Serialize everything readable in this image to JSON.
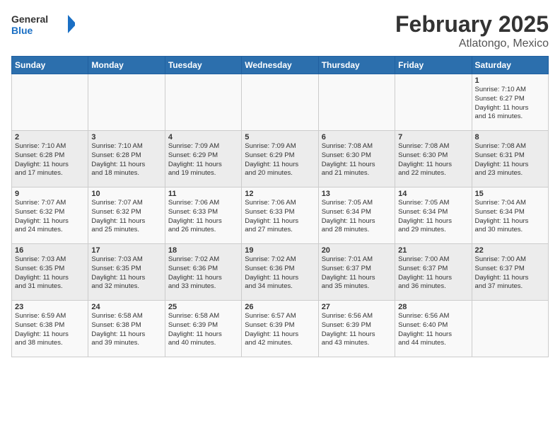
{
  "header": {
    "logo_general": "General",
    "logo_blue": "Blue",
    "month_title": "February 2025",
    "location": "Atlatongo, Mexico"
  },
  "weekdays": [
    "Sunday",
    "Monday",
    "Tuesday",
    "Wednesday",
    "Thursday",
    "Friday",
    "Saturday"
  ],
  "weeks": [
    [
      {
        "day": "",
        "info": ""
      },
      {
        "day": "",
        "info": ""
      },
      {
        "day": "",
        "info": ""
      },
      {
        "day": "",
        "info": ""
      },
      {
        "day": "",
        "info": ""
      },
      {
        "day": "",
        "info": ""
      },
      {
        "day": "1",
        "info": "Sunrise: 7:10 AM\nSunset: 6:27 PM\nDaylight: 11 hours\nand 16 minutes."
      }
    ],
    [
      {
        "day": "2",
        "info": "Sunrise: 7:10 AM\nSunset: 6:28 PM\nDaylight: 11 hours\nand 17 minutes."
      },
      {
        "day": "3",
        "info": "Sunrise: 7:10 AM\nSunset: 6:28 PM\nDaylight: 11 hours\nand 18 minutes."
      },
      {
        "day": "4",
        "info": "Sunrise: 7:09 AM\nSunset: 6:29 PM\nDaylight: 11 hours\nand 19 minutes."
      },
      {
        "day": "5",
        "info": "Sunrise: 7:09 AM\nSunset: 6:29 PM\nDaylight: 11 hours\nand 20 minutes."
      },
      {
        "day": "6",
        "info": "Sunrise: 7:08 AM\nSunset: 6:30 PM\nDaylight: 11 hours\nand 21 minutes."
      },
      {
        "day": "7",
        "info": "Sunrise: 7:08 AM\nSunset: 6:30 PM\nDaylight: 11 hours\nand 22 minutes."
      },
      {
        "day": "8",
        "info": "Sunrise: 7:08 AM\nSunset: 6:31 PM\nDaylight: 11 hours\nand 23 minutes."
      }
    ],
    [
      {
        "day": "9",
        "info": "Sunrise: 7:07 AM\nSunset: 6:32 PM\nDaylight: 11 hours\nand 24 minutes."
      },
      {
        "day": "10",
        "info": "Sunrise: 7:07 AM\nSunset: 6:32 PM\nDaylight: 11 hours\nand 25 minutes."
      },
      {
        "day": "11",
        "info": "Sunrise: 7:06 AM\nSunset: 6:33 PM\nDaylight: 11 hours\nand 26 minutes."
      },
      {
        "day": "12",
        "info": "Sunrise: 7:06 AM\nSunset: 6:33 PM\nDaylight: 11 hours\nand 27 minutes."
      },
      {
        "day": "13",
        "info": "Sunrise: 7:05 AM\nSunset: 6:34 PM\nDaylight: 11 hours\nand 28 minutes."
      },
      {
        "day": "14",
        "info": "Sunrise: 7:05 AM\nSunset: 6:34 PM\nDaylight: 11 hours\nand 29 minutes."
      },
      {
        "day": "15",
        "info": "Sunrise: 7:04 AM\nSunset: 6:34 PM\nDaylight: 11 hours\nand 30 minutes."
      }
    ],
    [
      {
        "day": "16",
        "info": "Sunrise: 7:03 AM\nSunset: 6:35 PM\nDaylight: 11 hours\nand 31 minutes."
      },
      {
        "day": "17",
        "info": "Sunrise: 7:03 AM\nSunset: 6:35 PM\nDaylight: 11 hours\nand 32 minutes."
      },
      {
        "day": "18",
        "info": "Sunrise: 7:02 AM\nSunset: 6:36 PM\nDaylight: 11 hours\nand 33 minutes."
      },
      {
        "day": "19",
        "info": "Sunrise: 7:02 AM\nSunset: 6:36 PM\nDaylight: 11 hours\nand 34 minutes."
      },
      {
        "day": "20",
        "info": "Sunrise: 7:01 AM\nSunset: 6:37 PM\nDaylight: 11 hours\nand 35 minutes."
      },
      {
        "day": "21",
        "info": "Sunrise: 7:00 AM\nSunset: 6:37 PM\nDaylight: 11 hours\nand 36 minutes."
      },
      {
        "day": "22",
        "info": "Sunrise: 7:00 AM\nSunset: 6:37 PM\nDaylight: 11 hours\nand 37 minutes."
      }
    ],
    [
      {
        "day": "23",
        "info": "Sunrise: 6:59 AM\nSunset: 6:38 PM\nDaylight: 11 hours\nand 38 minutes."
      },
      {
        "day": "24",
        "info": "Sunrise: 6:58 AM\nSunset: 6:38 PM\nDaylight: 11 hours\nand 39 minutes."
      },
      {
        "day": "25",
        "info": "Sunrise: 6:58 AM\nSunset: 6:39 PM\nDaylight: 11 hours\nand 40 minutes."
      },
      {
        "day": "26",
        "info": "Sunrise: 6:57 AM\nSunset: 6:39 PM\nDaylight: 11 hours\nand 42 minutes."
      },
      {
        "day": "27",
        "info": "Sunrise: 6:56 AM\nSunset: 6:39 PM\nDaylight: 11 hours\nand 43 minutes."
      },
      {
        "day": "28",
        "info": "Sunrise: 6:56 AM\nSunset: 6:40 PM\nDaylight: 11 hours\nand 44 minutes."
      },
      {
        "day": "",
        "info": ""
      }
    ]
  ]
}
